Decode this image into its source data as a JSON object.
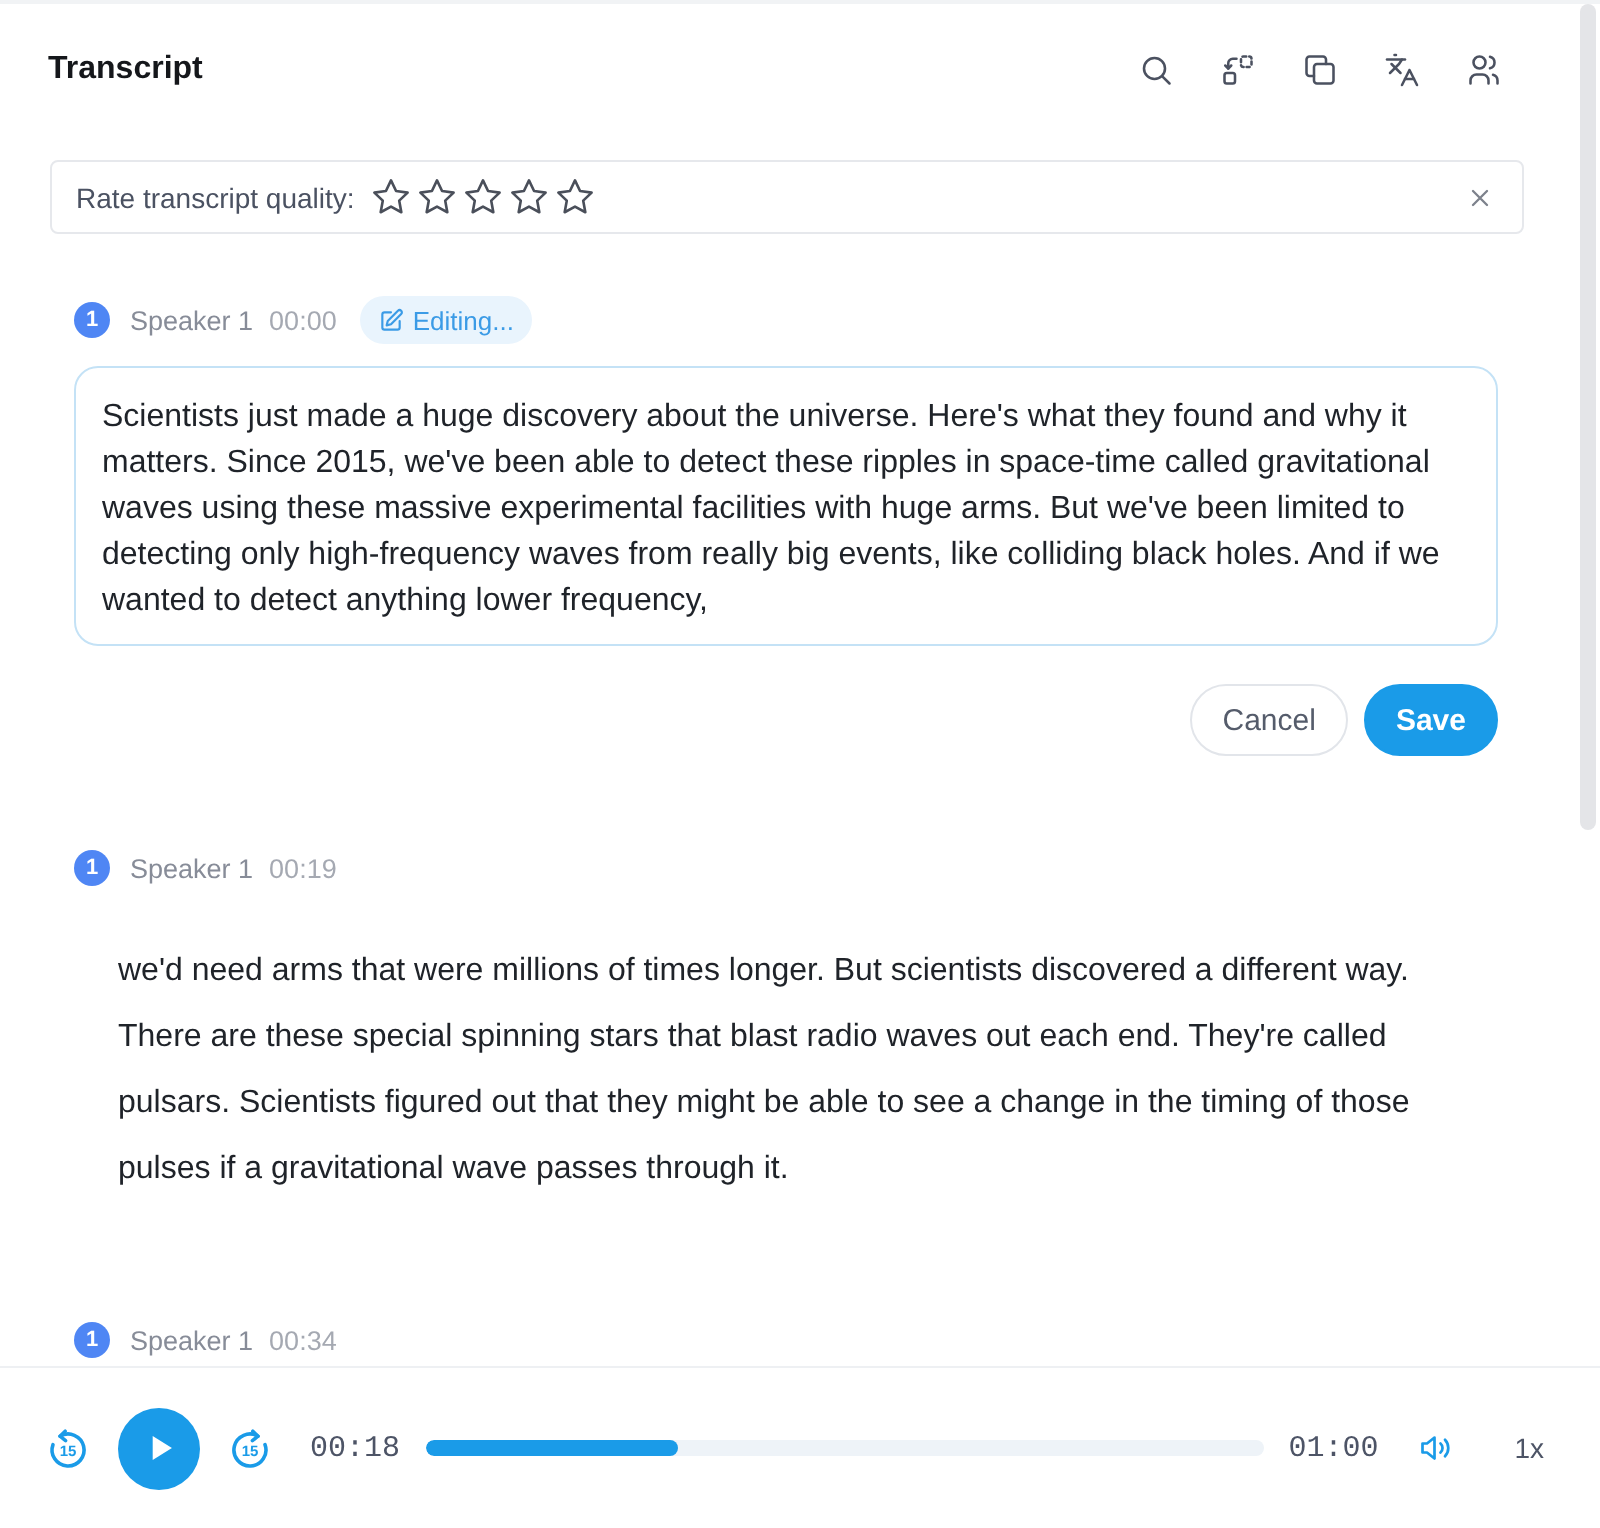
{
  "header": {
    "title": "Transcript",
    "tools": [
      {
        "kind": "search"
      },
      {
        "kind": "swap"
      },
      {
        "kind": "copy"
      },
      {
        "kind": "translate"
      },
      {
        "kind": "speakers"
      }
    ]
  },
  "rating": {
    "label": "Rate transcript quality:",
    "stars": 0
  },
  "segments": [
    {
      "badge": "1",
      "speaker": "Speaker 1",
      "time": "00:00",
      "editing": true,
      "status": "Editing...",
      "text": "Scientists just made a huge discovery about the universe. Here's what they found and why it matters. Since 2015, we've been able to detect these ripples in space-time called gravitational waves using these massive experimental facilities with huge arms. But we've been limited to detecting only high-frequency waves from really big events, like colliding black holes. And if we wanted to detect anything lower frequency,",
      "actions": [
        {
          "label": "Cancel",
          "kind": "secondary"
        },
        {
          "label": "Save",
          "kind": "primary"
        }
      ]
    },
    {
      "badge": "1",
      "speaker": "Speaker 1",
      "time": "00:19",
      "editing": false,
      "text": "we'd need arms that were millions of times longer. But scientists discovered a different way. There are these special spinning stars that blast radio waves out each end. They're called pulsars. Scientists figured out that they might be able to see a change in the timing of those pulses if a gravitational wave passes through it."
    },
    {
      "badge": "1",
      "speaker": "Speaker 1",
      "time": "00:34",
      "editing": false
    }
  ],
  "player": {
    "rewind": "15",
    "playing": false,
    "forward": "15",
    "elapsed": "00:18",
    "level": 0.3,
    "duration": "01:00",
    "speed": "1x"
  }
}
